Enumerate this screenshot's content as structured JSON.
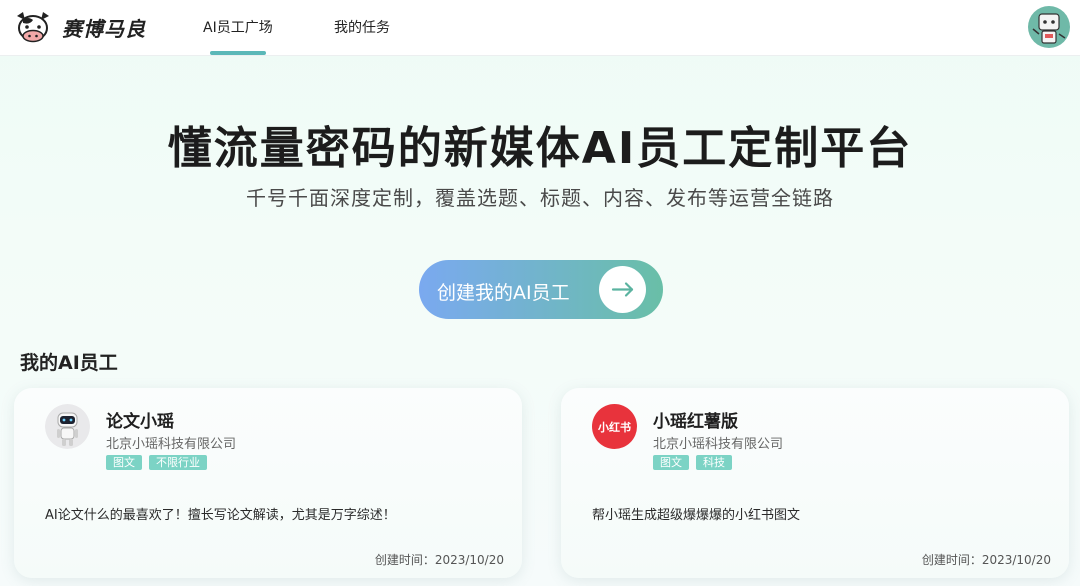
{
  "header": {
    "brand": "赛博马良",
    "nav": [
      "AI员工广场",
      "我的任务"
    ],
    "active_nav": 0,
    "accent": "#5bb8b8"
  },
  "hero": {
    "title": "懂流量密码的新媒体AI员工定制平台",
    "subtitle": "千号千面深度定制，覆盖选题、标题、内容、发布等运营全链路",
    "cta_label": "创建我的AI员工",
    "cta_icon": "arrow-right-icon"
  },
  "section": {
    "title": "我的AI员工"
  },
  "cards": [
    {
      "name": "论文小瑶",
      "company": "北京小瑶科技有限公司",
      "tags": [
        "图文",
        "不限行业"
      ],
      "desc": "AI论文什么的最喜欢了！擅长写论文解读，尤其是万字综述！",
      "date": "创建时间：2023/10/20",
      "avatar": "robot-avatar-icon"
    },
    {
      "name": "小瑶红薯版",
      "company": "北京小瑶科技有限公司",
      "tags": [
        "图文",
        "科技"
      ],
      "desc": "帮小瑶生成超级爆爆爆的小红书图文",
      "date": "创建时间：2023/10/20",
      "avatar": "xiaohongshu-logo-icon",
      "avatar_text": "小红书"
    }
  ],
  "colors": {
    "tag_bg": "#7cd3c5",
    "xiaohongshu_red": "#e8333c",
    "cta_start": "#7aa9f0",
    "cta_end": "#69bfa7"
  }
}
